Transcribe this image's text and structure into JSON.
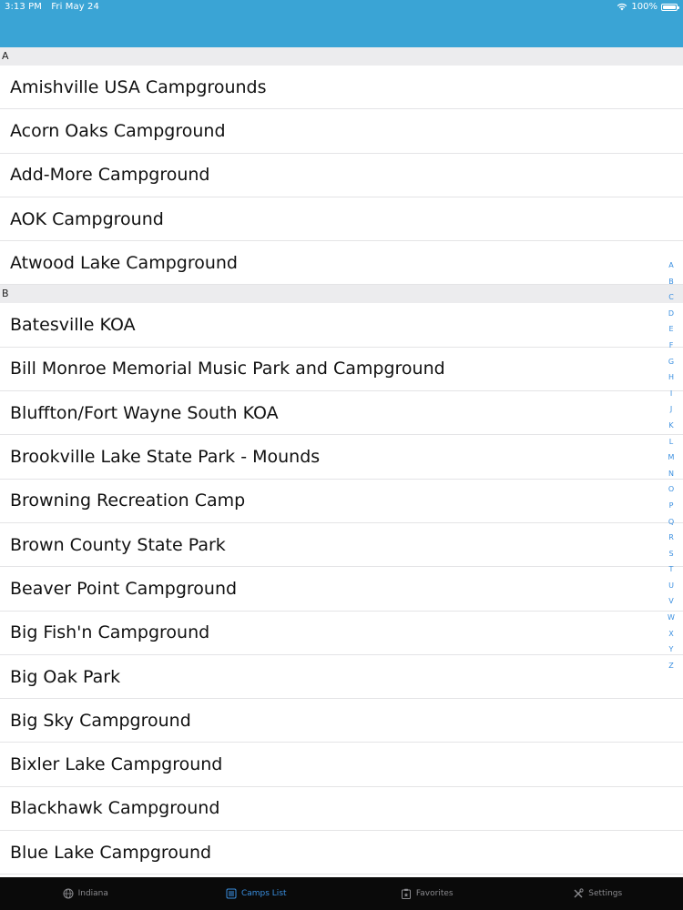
{
  "status_bar": {
    "time": "3:13 PM",
    "date": "Fri May 24",
    "battery": "100%"
  },
  "sections": [
    {
      "letter": "A",
      "items": [
        "Amishville USA Campgrounds",
        "Acorn Oaks Campground",
        "Add-More Campground",
        "AOK Campground",
        "Atwood Lake Campground"
      ]
    },
    {
      "letter": "B",
      "items": [
        "Batesville KOA",
        "Bill Monroe Memorial Music Park and Campground",
        "Bluffton/Fort Wayne South KOA",
        "Brookville Lake State Park - Mounds",
        "Browning Recreation Camp",
        "Brown County State Park",
        "Beaver Point Campground",
        "Big Fish'n Campground",
        "Big Oak Park",
        "Big Sky Campground",
        "Bixler Lake Campground",
        "Blackhawk Campground",
        "Blue Lake Campground"
      ]
    }
  ],
  "index_letters": [
    "A",
    "B",
    "C",
    "D",
    "E",
    "F",
    "G",
    "H",
    "I",
    "J",
    "K",
    "L",
    "M",
    "N",
    "O",
    "P",
    "Q",
    "R",
    "S",
    "T",
    "U",
    "V",
    "W",
    "X",
    "Y",
    "Z"
  ],
  "tabs": [
    {
      "label": "Indiana",
      "icon": "globe-icon",
      "active": false
    },
    {
      "label": "Camps List",
      "icon": "list-icon",
      "active": true
    },
    {
      "label": "Favorites",
      "icon": "clipboard-icon",
      "active": false
    },
    {
      "label": "Settings",
      "icon": "tools-icon",
      "active": false
    }
  ],
  "colors": {
    "accent": "#3a8fe0",
    "nav_bar": "#3aa4d5",
    "tab_bar": "#0a0a0a",
    "section_header": "#ececee"
  }
}
